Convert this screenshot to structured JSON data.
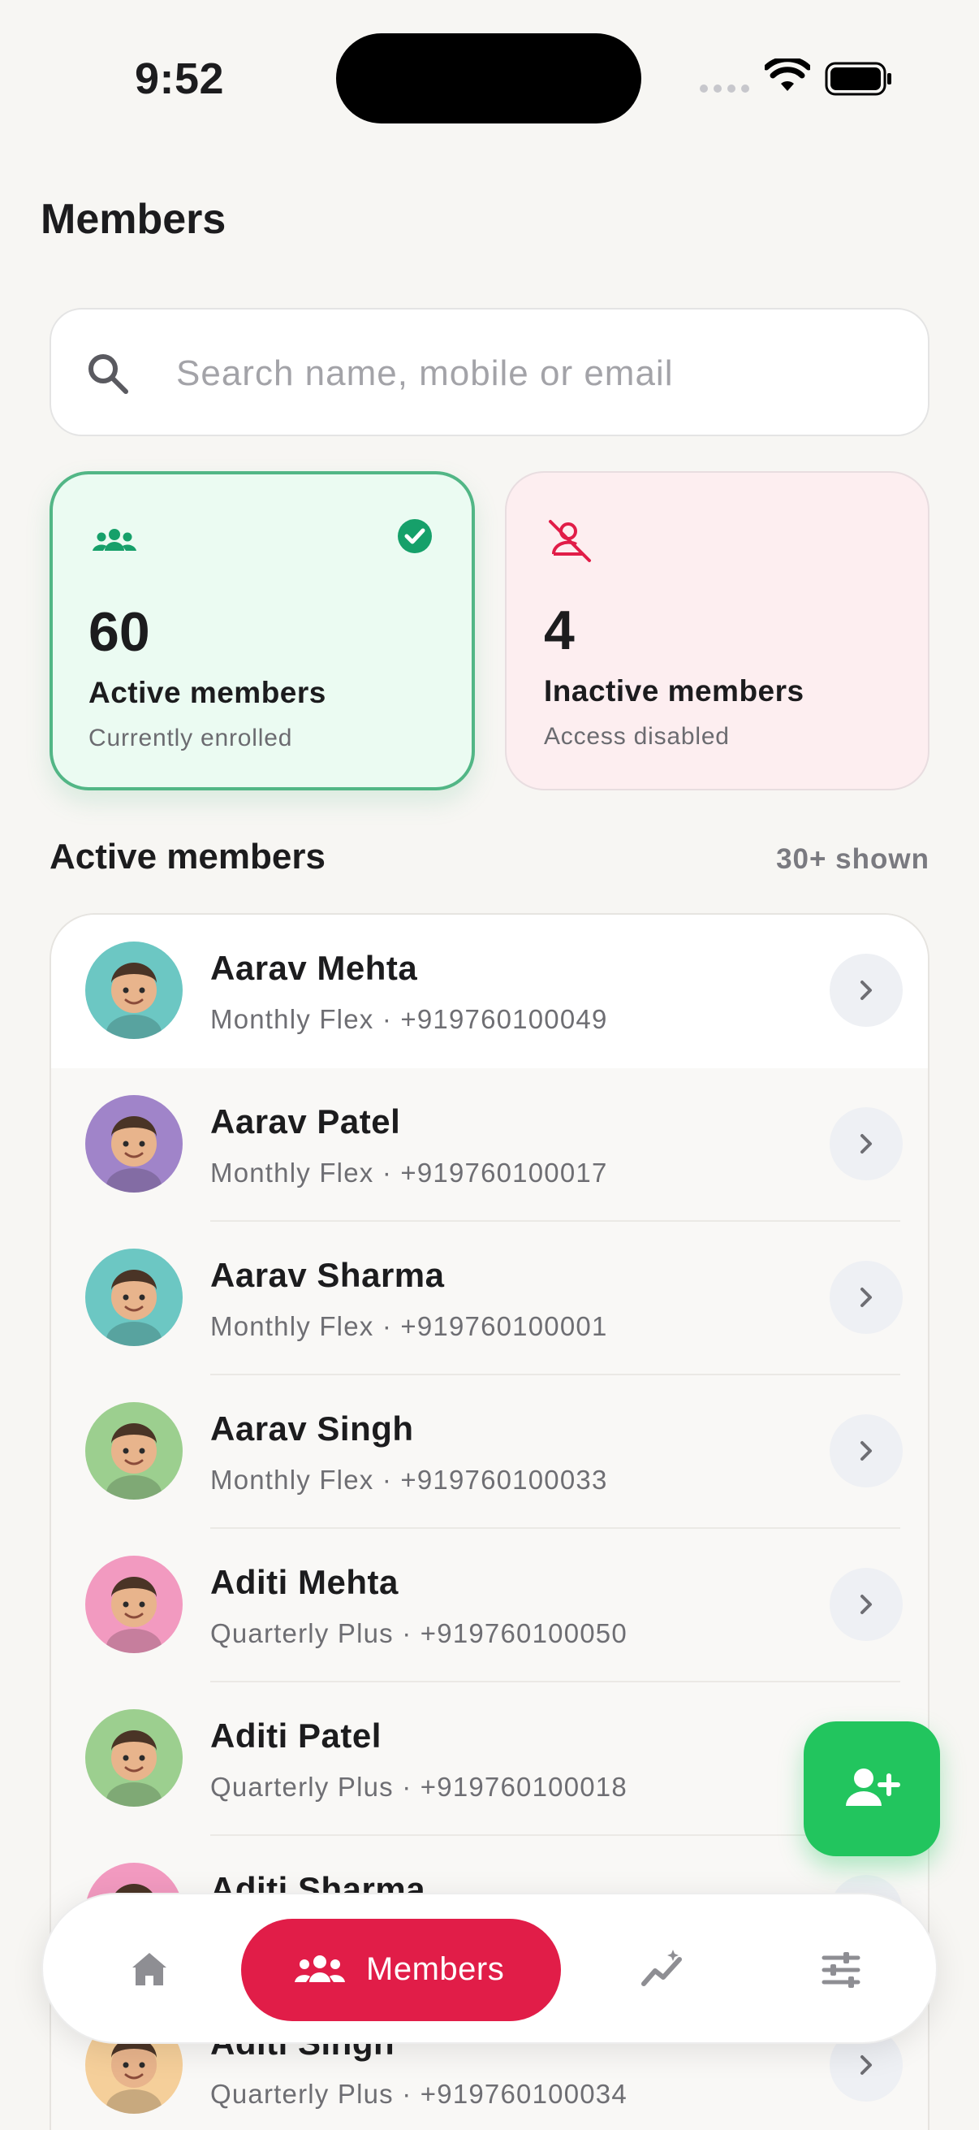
{
  "status_bar": {
    "time": "9:52"
  },
  "header": {
    "title": "Members"
  },
  "search": {
    "placeholder": "Search name, mobile or email",
    "value": ""
  },
  "stats": {
    "active": {
      "count": "60",
      "label": "Active members",
      "sub": "Currently enrolled",
      "selected": true
    },
    "inactive": {
      "count": "4",
      "label": "Inactive members",
      "sub": "Access disabled"
    }
  },
  "section": {
    "title": "Active members",
    "count_label": "30+ shown"
  },
  "members": [
    {
      "name": "Aarav Mehta",
      "meta": "Monthly Flex · +919760100049",
      "avatar_color": "#6cc7c3"
    },
    {
      "name": "Aarav Patel",
      "meta": "Monthly Flex · +919760100017",
      "avatar_color": "#a084c9"
    },
    {
      "name": "Aarav Sharma",
      "meta": "Monthly Flex · +919760100001",
      "avatar_color": "#6cc7c3"
    },
    {
      "name": "Aarav Singh",
      "meta": "Monthly Flex · +919760100033",
      "avatar_color": "#9ccf8f"
    },
    {
      "name": "Aditi Mehta",
      "meta": "Quarterly Plus · +919760100050",
      "avatar_color": "#f29ac0"
    },
    {
      "name": "Aditi Patel",
      "meta": "Quarterly Plus · +919760100018",
      "avatar_color": "#9ccf8f"
    },
    {
      "name": "Aditi Sharma",
      "meta": "",
      "avatar_color": "#f29ac0"
    },
    {
      "name": "Aditi Singh",
      "meta": "Quarterly Plus · +919760100034",
      "avatar_color": "#f5cf9a"
    }
  ],
  "bottom_nav": {
    "members_label": "Members",
    "items": [
      "home-icon",
      "members-icon",
      "analytics-icon",
      "settings-icon"
    ]
  },
  "colors": {
    "accent": "#e11d48",
    "active_green": "#16a06a",
    "inactive_red": "#e11d48",
    "fab": "#22c55e"
  }
}
